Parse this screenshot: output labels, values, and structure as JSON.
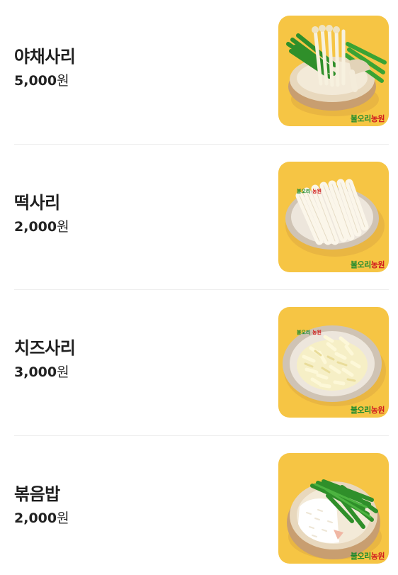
{
  "items": [
    {
      "name": "야채사리",
      "price_number": "5,000",
      "price_unit": "원",
      "image": "vegetable-side-bowl-image",
      "brand_green": "불오리",
      "brand_red": "농원"
    },
    {
      "name": "떡사리",
      "price_number": "2,000",
      "price_unit": "원",
      "image": "rice-cake-side-bowl-image",
      "brand_green": "불오리",
      "brand_red": "농원"
    },
    {
      "name": "치즈사리",
      "price_number": "3,000",
      "price_unit": "원",
      "image": "cheese-side-bowl-image",
      "brand_green": "불오리",
      "brand_red": "농원"
    },
    {
      "name": "볶음밥",
      "price_number": "2,000",
      "price_unit": "원",
      "image": "fried-rice-bowl-image",
      "brand_green": "불오리",
      "brand_red": "농원"
    }
  ],
  "colors": {
    "thumb_background": "#f6c544",
    "brand_green": "#1c8a2e",
    "brand_red": "#d11f1f",
    "divider": "#eeeeee"
  }
}
